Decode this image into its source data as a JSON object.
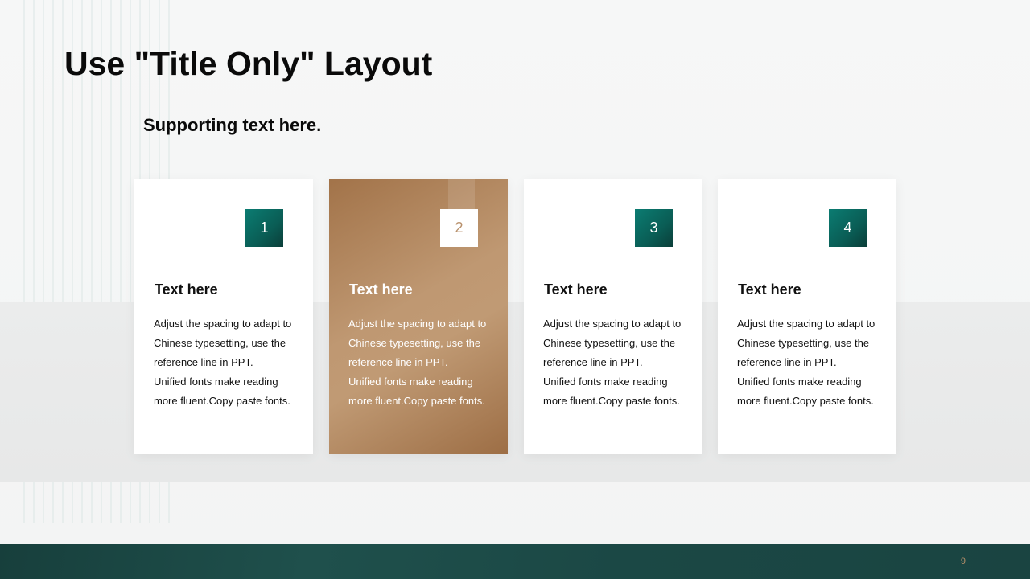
{
  "slide": {
    "title": "Use \"Title Only\" Layout",
    "subtitle": "Supporting text here.",
    "page_number": "9"
  },
  "colors": {
    "teal": "#0a5d55",
    "bronze": "#b0845c",
    "footer": "#1b4845"
  },
  "cards": [
    {
      "number": "1",
      "heading": "Text here",
      "lines": [
        "Adjust the spacing to adapt to",
        "Chinese  typesetting, use the",
        "reference line in PPT.",
        "Unified  fonts make reading",
        "more fluent.Copy paste fonts."
      ]
    },
    {
      "number": "2",
      "heading": "Text here",
      "lines": [
        "Adjust the spacing to adapt to",
        "Chinese  typesetting, use the",
        "reference line in PPT.",
        "Unified  fonts make reading",
        "more fluent.Copy paste fonts."
      ]
    },
    {
      "number": "3",
      "heading": "Text here",
      "lines": [
        "Adjust the spacing to adapt to",
        "Chinese  typesetting, use the",
        "reference line in PPT.",
        "Unified  fonts make reading",
        "more fluent.Copy paste fonts."
      ]
    },
    {
      "number": "4",
      "heading": "Text here",
      "lines": [
        "Adjust the spacing to adapt to",
        "Chinese  typesetting, use the",
        "reference line in PPT.",
        "Unified  fonts make reading",
        "more fluent.Copy paste fonts."
      ]
    }
  ]
}
